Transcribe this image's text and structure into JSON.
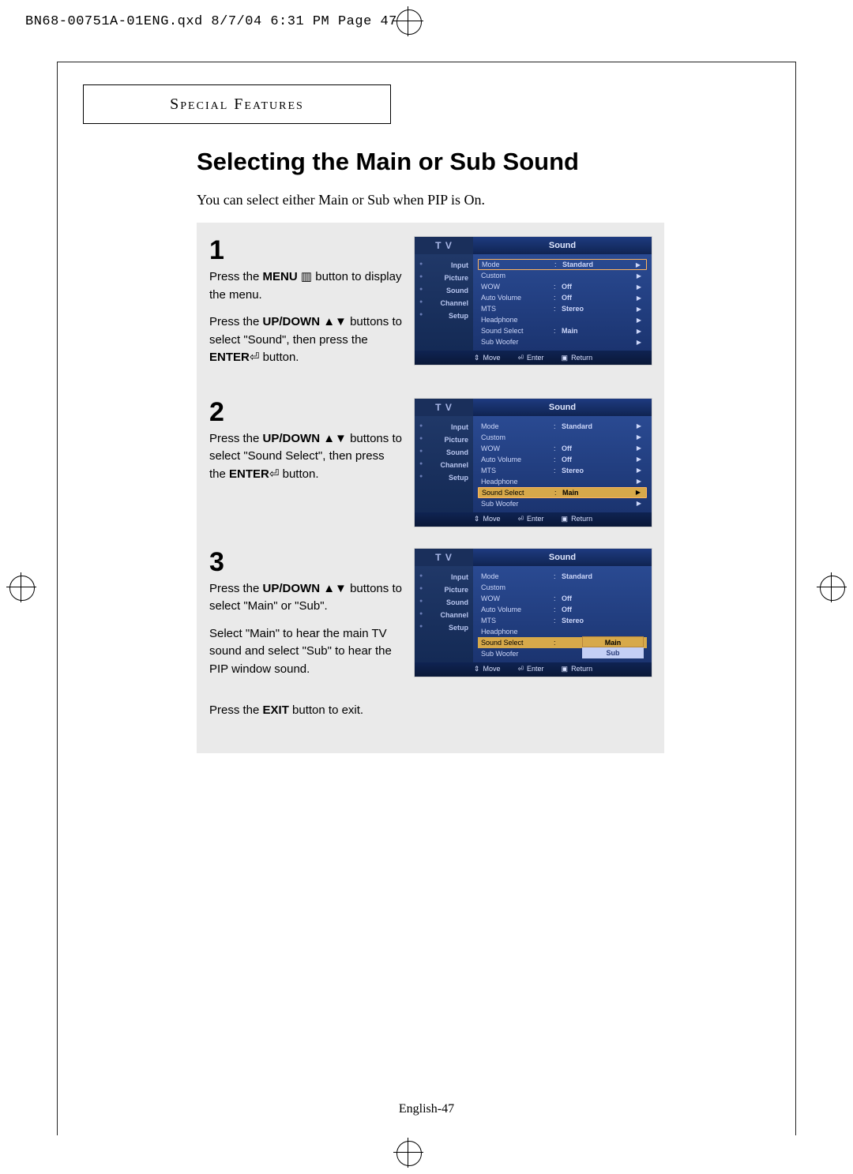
{
  "print_header": "BN68-00751A-01ENG.qxd  8/7/04 6:31 PM  Page 47",
  "section_label": "Special Features",
  "title": "Selecting the Main or Sub Sound",
  "subtitle": "You can select either Main or Sub when PIP is On.",
  "page_footer": "English-47",
  "steps": {
    "s1": {
      "num": "1",
      "line1a": "Press the ",
      "bold1": "MENU",
      "line1b": " button to display the menu.",
      "line2a": "Press the ",
      "bold2": "UP/DOWN",
      "line2b": " buttons to select \"Sound\", then press the ",
      "bold3": "ENTER",
      "line2c": " button."
    },
    "s2": {
      "num": "2",
      "line1a": "Press the ",
      "bold1": "UP/DOWN",
      "line1b": " buttons to select \"Sound Select\", then press the ",
      "bold2": "ENTER",
      "line1c": " button."
    },
    "s3": {
      "num": "3",
      "line1a": "Press the ",
      "bold1": "UP/DOWN",
      "line1b": " buttons to select \"Main\" or \"Sub\".",
      "line2": "Select \"Main\" to hear the main TV sound and select \"Sub\" to hear the PIP window sound.",
      "line3a": "Press the ",
      "bold3": "EXIT",
      "line3b": " button to exit."
    }
  },
  "osd": {
    "tv_label": "T V",
    "panel_title": "Sound",
    "side": [
      "Input",
      "Picture",
      "Sound",
      "Channel",
      "Setup"
    ],
    "rows": [
      {
        "label": "Mode",
        "value": "Standard"
      },
      {
        "label": "Custom",
        "value": ""
      },
      {
        "label": "WOW",
        "value": "Off"
      },
      {
        "label": "Auto Volume",
        "value": "Off"
      },
      {
        "label": "MTS",
        "value": "Stereo"
      },
      {
        "label": "Headphone",
        "value": ""
      },
      {
        "label": "Sound Select",
        "value": "Main"
      },
      {
        "label": "Sub Woofer",
        "value": ""
      }
    ],
    "foot": {
      "move": "Move",
      "enter": "Enter",
      "return": "Return"
    },
    "step3_options": {
      "selected": "Main",
      "other": "Sub"
    }
  }
}
